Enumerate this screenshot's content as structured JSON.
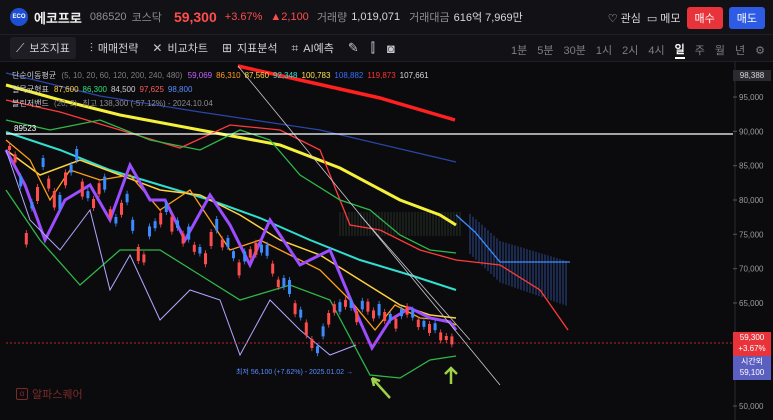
{
  "header": {
    "logo_text": "ECO",
    "name": "에코프로",
    "code": "086520",
    "market": "코스닥",
    "price": "59,300",
    "change_pct": "+3.67%",
    "change_amt": "▲2,100",
    "volume_label": "거래량",
    "volume": "1,019,071",
    "value_label": "거래대금",
    "value": "616억 7,969만",
    "interest_label": "관심",
    "memo_label": "메모",
    "buy_label": "매수",
    "sell_label": "매도"
  },
  "toolbar": {
    "items": [
      "보조지표",
      "매매전략",
      "비교차트",
      "지표분석",
      "AI예측"
    ],
    "periods": [
      "1분",
      "5분",
      "30분",
      "1시",
      "2시",
      "4시",
      "일",
      "주",
      "월",
      "년"
    ],
    "selected_period": "일"
  },
  "legend": {
    "sma": {
      "name": "단순이동평균",
      "params": "(5, 10, 20, 60, 120, 200, 240, 480)",
      "values": [
        {
          "v": "59,069",
          "c": "#c264ff"
        },
        {
          "v": "86,310",
          "c": "#ff9f1a"
        },
        {
          "v": "87,560",
          "c": "#ffd23f"
        },
        {
          "v": "92,348",
          "c": "#2fe0d0"
        },
        {
          "v": "100,783",
          "c": "#ffe14d"
        },
        {
          "v": "108,882",
          "c": "#3b6dff"
        },
        {
          "v": "119,873",
          "c": "#ff3030"
        },
        {
          "v": "107,661",
          "c": "#d8d8dc"
        }
      ]
    },
    "ichimoku": {
      "name": "일목균형표",
      "values": [
        {
          "v": "87,600",
          "c": "#ffd23f"
        },
        {
          "v": "86,300",
          "c": "#2fe07a"
        },
        {
          "v": "84,500",
          "c": "#cfcfd4"
        },
        {
          "v": "97,625",
          "c": "#ff5a5a"
        },
        {
          "v": "98,800",
          "c": "#5a8cff"
        }
      ]
    },
    "bollinger": {
      "name": "볼린저밴드",
      "params": "(20, 2)",
      "values": [
        {
          "v": "최고 138,300 (-57.12%) - 2024.10.04",
          "c": "#8d8d93"
        }
      ]
    }
  },
  "axis": {
    "ticks": [
      "95,000",
      "90,000",
      "85,000",
      "80,000",
      "75,000",
      "70,000",
      "65,000",
      "60,000",
      "55,000",
      "50,000"
    ],
    "top_box": "98,388",
    "level_label": "89523",
    "price_box_price": "59,300",
    "price_box_pct": "+3.67%",
    "time_box_label": "시간외",
    "time_box_price": "59,100"
  },
  "annotations": {
    "low_text": "최저 56,100 (+7.62%) - 2025.01.02 →"
  },
  "watermark": {
    "text": "알파스퀘어",
    "icon": "α"
  },
  "colors": {
    "up": "#ff4d4d",
    "down": "#3b8bff",
    "buy": "#e8333a",
    "sell": "#2d5be3"
  }
}
